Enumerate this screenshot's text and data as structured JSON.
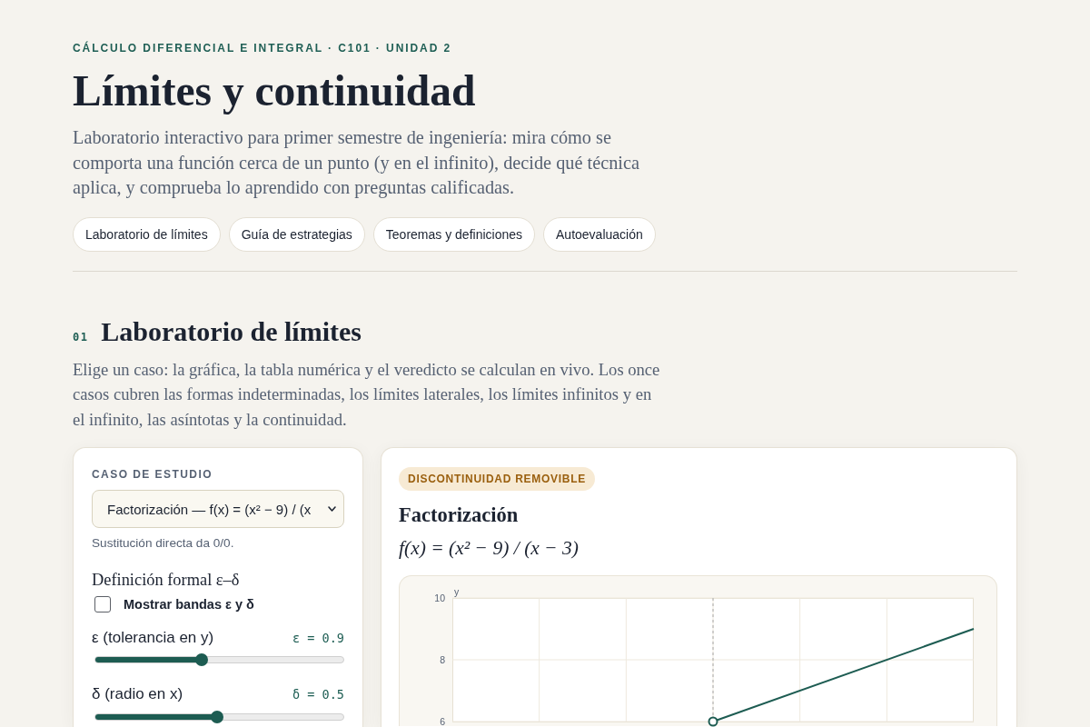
{
  "header": {
    "eyebrow": "CÁLCULO DIFERENCIAL E INTEGRAL · C101 · UNIDAD 2",
    "title": "Límites y continuidad",
    "intro": "Laboratorio interactivo para primer semestre de ingeniería: mira cómo se comporta una función cerca de un punto (y en el infinito), decide qué técnica aplica, y comprueba lo aprendido con preguntas calificadas.",
    "nav": [
      {
        "label": "Laboratorio de límites"
      },
      {
        "label": "Guía de estrategias"
      },
      {
        "label": "Teoremas y definiciones"
      },
      {
        "label": "Autoevaluación"
      }
    ]
  },
  "section": {
    "number": "01",
    "title": "Laboratorio de límites",
    "intro": "Elige un caso: la gráfica, la tabla numérica y el veredicto se calculan en vivo. Los once casos cubren las formas indeterminadas, los límites laterales, los límites infinitos y en el infinito, las asíntotas y la continuidad."
  },
  "controls": {
    "case_label": "CASO DE ESTUDIO",
    "case_select": {
      "value": "Factorización — f(x) = (x² − 9) / (x"
    },
    "case_hint": "Sustitución directa da 0/0.",
    "formal_title": "Definición formal ε–δ",
    "show_bands": {
      "label": "Mostrar bandas ε y δ",
      "checked": false
    },
    "sliders": [
      {
        "label": "ε (tolerancia en y)",
        "reading": "ε = 0.9",
        "level": 0.43
      },
      {
        "label": "δ (radio en x)",
        "reading": "δ = 0.5",
        "level": 0.49
      }
    ]
  },
  "result": {
    "badge": "DISCONTINUIDAD REMOVIBLE",
    "title": "Factorización",
    "formula": "f(x) = (x² − 9) / (x − 3)",
    "graph": {
      "axis_label": "y",
      "y_ticks": [
        "10",
        "8",
        "6"
      ]
    }
  }
}
